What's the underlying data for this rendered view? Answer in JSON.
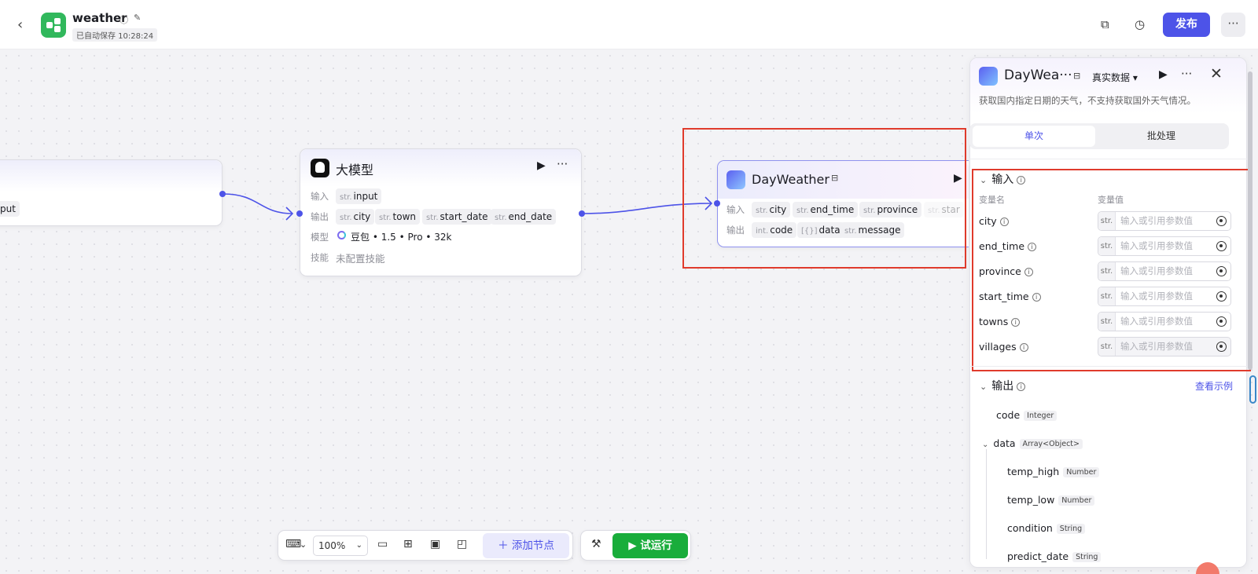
{
  "header": {
    "back_icon": "‹",
    "app_title": "weather",
    "autosave": "已自动保存 10:28:24",
    "publish_label": "发布",
    "more_label": "···"
  },
  "colors": {
    "accent": "#4d53e8",
    "run_green": "#19ad3b",
    "annotation_red": "#e03b2c",
    "logo_green": "#31b85c"
  },
  "start_node": {
    "output_tag": "put"
  },
  "llm_node": {
    "title": "大模型",
    "input_label": "输入",
    "inputs": [
      {
        "type": "str.",
        "name": "input"
      }
    ],
    "output_label": "输出",
    "outputs": [
      {
        "type": "str.",
        "name": "city"
      },
      {
        "type": "str.",
        "name": "town"
      },
      {
        "type": "str.",
        "name": "start_date"
      },
      {
        "type": "str.",
        "name": "end_date"
      }
    ],
    "model_label": "模型",
    "model_value": "豆包 • 1.5 • Pro • 32k",
    "skill_label": "技能",
    "skill_value": "未配置技能"
  },
  "weather_node": {
    "title": "DayWeather",
    "input_label": "输入",
    "inputs": [
      {
        "type": "str.",
        "name": "city"
      },
      {
        "type": "str.",
        "name": "end_time"
      },
      {
        "type": "str.",
        "name": "province"
      },
      {
        "type": "str.",
        "name": "star"
      }
    ],
    "output_label": "输出",
    "outputs": [
      {
        "type": "int.",
        "name": "code"
      },
      {
        "type": "[{}]",
        "name": "data"
      },
      {
        "type": "str.",
        "name": "message"
      }
    ]
  },
  "panel": {
    "title": "DayWea···",
    "data_mode": "真实数据",
    "description": "获取国内指定日期的天气，不支持获取国外天气情况。",
    "tabs": [
      "单次",
      "批处理"
    ],
    "input_section": "输入",
    "col_name": "变量名",
    "col_value": "变量值",
    "params": [
      {
        "name": "city",
        "type": "str.",
        "placeholder": "输入或引用参数值"
      },
      {
        "name": "end_time",
        "type": "str.",
        "placeholder": "输入或引用参数值"
      },
      {
        "name": "province",
        "type": "str.",
        "placeholder": "输入或引用参数值"
      },
      {
        "name": "start_time",
        "type": "str.",
        "placeholder": "输入或引用参数值"
      },
      {
        "name": "towns",
        "type": "str.",
        "placeholder": "输入或引用参数值"
      },
      {
        "name": "villages",
        "type": "str.",
        "placeholder": "输入或引用参数值"
      }
    ],
    "output_section": "输出",
    "view_example": "查看示例",
    "outputs": [
      {
        "name": "code",
        "type": "Integer"
      },
      {
        "name": "data",
        "type": "Array<Object>"
      },
      {
        "name": "temp_high",
        "type": "Number"
      },
      {
        "name": "temp_low",
        "type": "Number"
      },
      {
        "name": "condition",
        "type": "String"
      },
      {
        "name": "predict_date",
        "type": "String"
      }
    ]
  },
  "toolbar": {
    "zoom": "100%",
    "add_node": "添加节点",
    "run": "试运行"
  }
}
